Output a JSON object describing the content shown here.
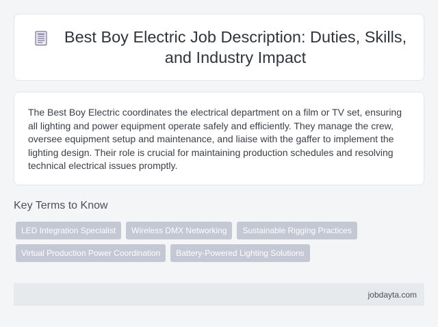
{
  "header": {
    "icon": "document-icon",
    "title": "Best Boy Electric Job Description: Duties, Skills, and Industry Impact"
  },
  "description": {
    "text": "The Best Boy Electric coordinates the electrical department on a film or TV set, ensuring all lighting and power equipment operate safely and efficiently. They manage the crew, oversee equipment setup and maintenance, and liaise with the gaffer to implement the lighting design. Their role is crucial for maintaining production schedules and resolving technical electrical issues promptly."
  },
  "key_terms": {
    "heading": "Key Terms to Know",
    "tags": [
      "LED Integration Specialist",
      "Wireless DMX Networking",
      "Sustainable Rigging Practices",
      "Virtual Production Power Coordination",
      "Battery-Powered Lighting Solutions"
    ]
  },
  "footer": {
    "site": "jobdayta.com"
  },
  "colors": {
    "background": "#f3f5f7",
    "card": "#ffffff",
    "tag": "#c4c8d4",
    "footer": "#e6eaed"
  }
}
